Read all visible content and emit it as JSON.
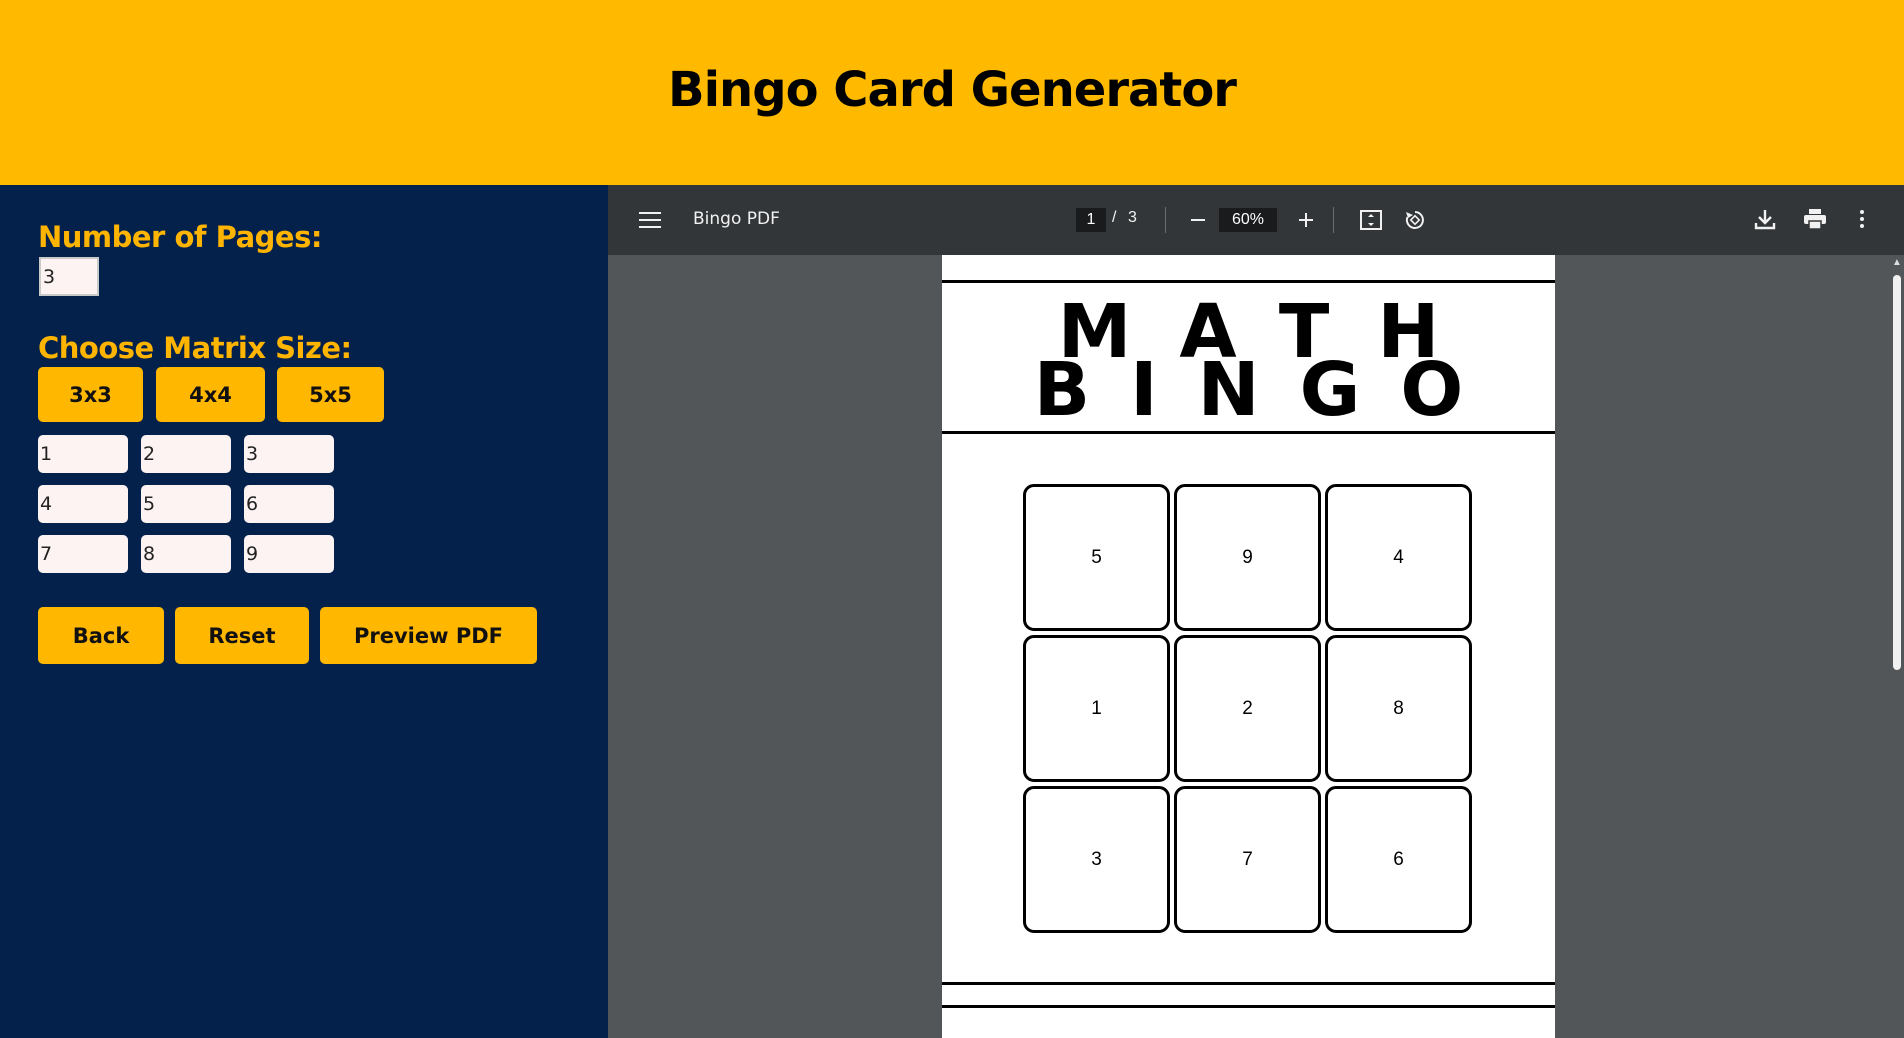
{
  "header": {
    "title": "Bingo Card Generator"
  },
  "form": {
    "pages_label": "Number of Pages:",
    "pages_value": "3",
    "matrix_label": "Choose Matrix Size:",
    "sizes": [
      "3x3",
      "4x4",
      "5x5"
    ],
    "cells": [
      "1",
      "2",
      "3",
      "4",
      "5",
      "6",
      "7",
      "8",
      "9"
    ],
    "actions": {
      "back": "Back",
      "reset": "Reset",
      "preview": "Preview PDF"
    }
  },
  "viewer": {
    "doc_title": "Bingo PDF",
    "current_page": "1",
    "page_sep": "/",
    "total_pages": "3",
    "zoom": "60%",
    "icons": [
      "menu-icon",
      "zoom-out-icon",
      "zoom-in-icon",
      "fit-page-icon",
      "rotate-icon",
      "download-icon",
      "print-icon",
      "more-icon"
    ]
  },
  "pdf": {
    "title_line1": "MATH",
    "title_line2": "BINGO",
    "grid": [
      "5",
      "9",
      "4",
      "1",
      "2",
      "8",
      "3",
      "7",
      "6"
    ]
  },
  "colors": {
    "header": "#ffba00",
    "panel": "#04214c",
    "accent": "#ffb700"
  }
}
